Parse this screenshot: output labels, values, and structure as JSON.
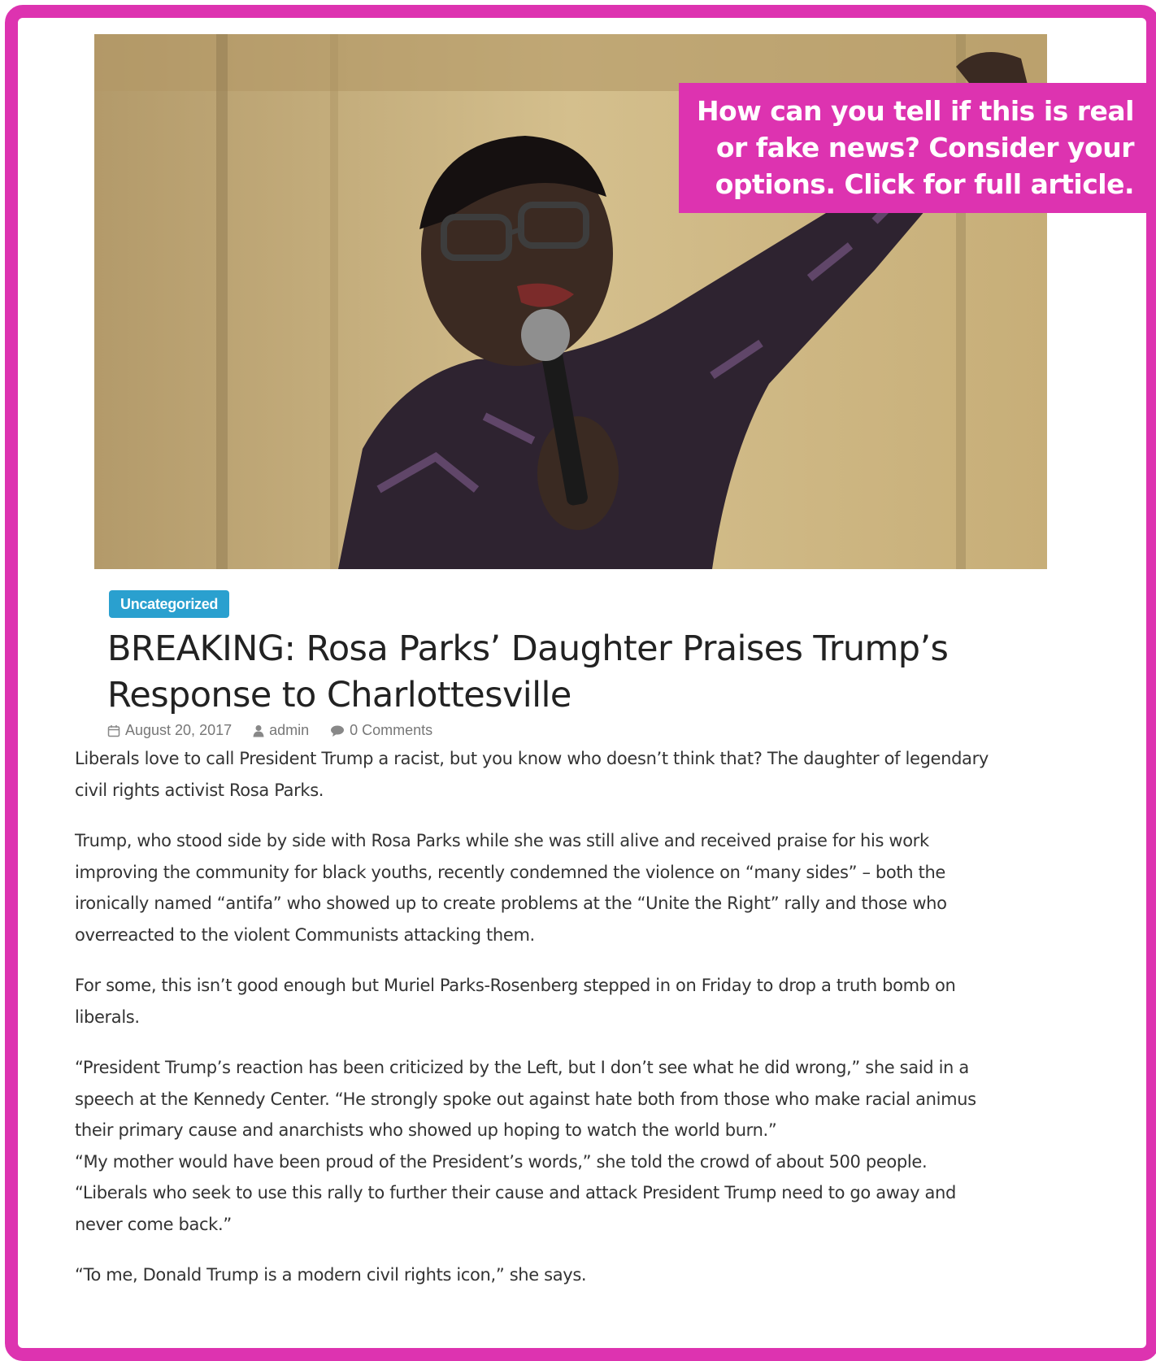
{
  "hero": {
    "callout_lines": [
      "How can you tell if this is real",
      "or fake news? Consider your",
      "options. Click for full article."
    ]
  },
  "article": {
    "category": "Uncategorized",
    "title_lines": [
      "BREAKING: Rosa Parks’ Daughter Praises Trump’s",
      "Response to Charlottesville"
    ],
    "date": "August 20, 2017",
    "author": "admin",
    "comments": "0 Comments",
    "paragraphs": [
      [
        "Liberals love to call President Trump a racist, but you know who doesn’t think that? The daughter of legendary",
        "civil rights activist Rosa Parks."
      ],
      [
        "Trump, who stood side by side with Rosa Parks while she was still alive and received praise for his work",
        "improving the community for black youths, recently condemned the violence on “many sides” – both the",
        "ironically named “antifa” who showed up to create problems at the “Unite the Right” rally and those who",
        "overreacted to the violent Communists attacking them."
      ],
      [
        "For some, this isn’t good enough but Muriel Parks-Rosenberg stepped in on Friday to drop a truth bomb on",
        "liberals."
      ],
      [
        "“President Trump’s reaction has been criticized by the Left, but I don’t see what he did wrong,” she said in a",
        "speech at the Kennedy Center. “He strongly spoke out against hate both from those who make racial animus",
        "their primary cause and anarchists who showed up hoping to watch the world burn.”",
        "“My mother would have been proud of the President’s words,” she told the crowd of about 500 people.",
        "“Liberals who seek to use this rally to further their cause and attack President Trump need to go away and",
        "never come back.”"
      ],
      [
        "“To me, Donald Trump is a modern civil rights icon,” she says."
      ]
    ]
  },
  "colors": {
    "frame": "#dd33b0",
    "badge": "#2aa0cf",
    "title": "#222222",
    "body": "#333333"
  }
}
